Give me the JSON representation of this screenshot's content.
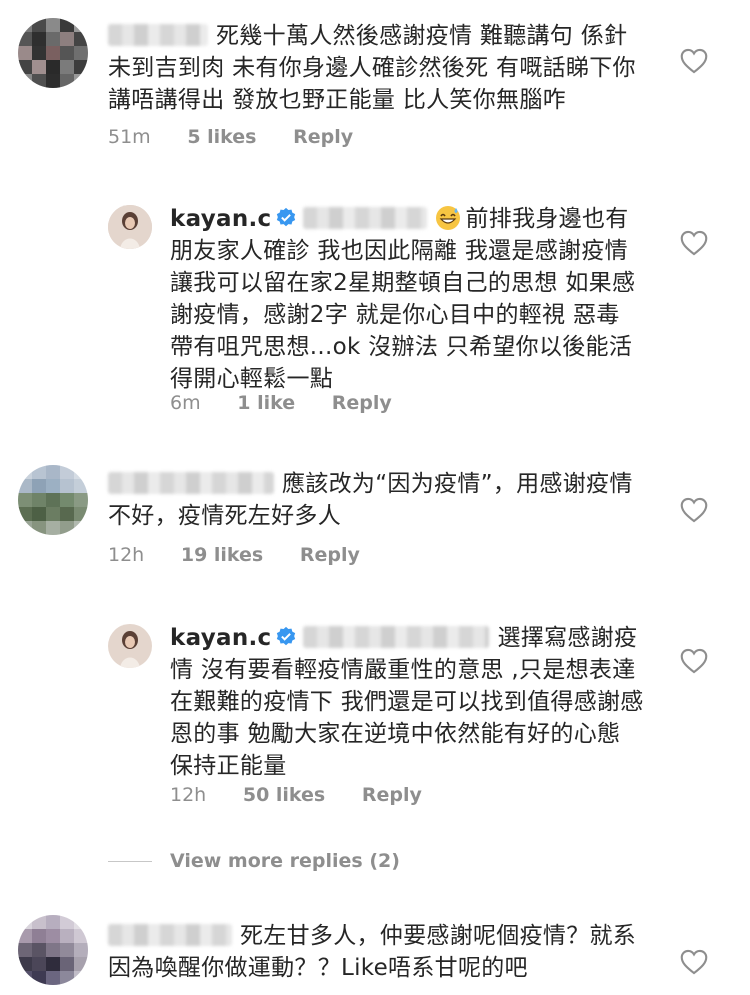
{
  "comments": [
    {
      "text": "死幾十萬人然後感謝疫情 難聽講句 係針未到吉到肉 未有你身邊人確診然後死 有嘅話睇下你講唔講得出 發放乜野正能量 比人笑你無腦咋",
      "time": "51m",
      "likes": "5 likes",
      "reply": "Reply"
    },
    {
      "username": "kayan.c",
      "text": "前排我身邊也有朋友家人確診 我也因此隔離 我還是感謝疫情 讓我可以留在家2星期整頓自己的思想 如果感謝疫情，感謝2字 就是你心目中的輕視 惡毒 帶有咀咒思想...ok 沒辦法 只希望你以後能活得開心輕鬆一點",
      "time": "6m",
      "likes": "1 like",
      "reply": "Reply"
    },
    {
      "text": "應該改为“因为疫情”，用感谢疫情不好，疫情死左好多人",
      "time": "12h",
      "likes": "19 likes",
      "reply": "Reply"
    },
    {
      "username": "kayan.c",
      "text": "選擇寫感謝疫情 沒有要看輕疫情嚴重性的意思 ,只是想表達 在艱難的疫情下 我們還是可以找到值得感謝感恩的事 勉勵大家在逆境中依然能有好的心態 保持正能量",
      "time": "12h",
      "likes": "50 likes",
      "reply": "Reply"
    },
    {
      "text": "死左甘多人，仲要感謝呢個疫情？就系因為喚醒你做運動？？Like唔系甘呢的吧"
    }
  ],
  "view_more": "View more replies (2)",
  "colors": {
    "verified": "#3897f0",
    "meta": "#8e8e8e",
    "text": "#262626"
  }
}
